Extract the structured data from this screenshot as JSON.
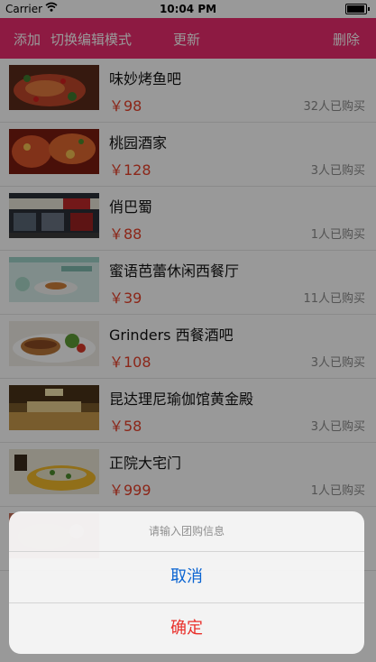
{
  "status_bar": {
    "carrier": "Carrier",
    "time": "10:04 PM"
  },
  "nav": {
    "add": "添加",
    "edit_mode": "切换编辑模式",
    "update": "更新",
    "delete": "删除"
  },
  "deals": [
    {
      "name": "味妙烤鱼吧",
      "price": "￥98",
      "sold": "32人已购买"
    },
    {
      "name": "桃园酒家",
      "price": "￥128",
      "sold": "3人已购买"
    },
    {
      "name": "俏巴蜀",
      "price": "￥88",
      "sold": "1人已购买"
    },
    {
      "name": "蜜语芭蕾休闲西餐厅",
      "price": "￥39",
      "sold": "11人已购买"
    },
    {
      "name": "Grinders 西餐酒吧",
      "price": "￥108",
      "sold": "3人已购买"
    },
    {
      "name": "昆达理尼瑜伽馆黄金殿",
      "price": "￥58",
      "sold": "3人已购买"
    },
    {
      "name": "正院大宅门",
      "price": "￥999",
      "sold": "1人已购买"
    },
    {
      "name": "",
      "price": "",
      "sold": ""
    }
  ],
  "action_sheet": {
    "title": "请输入团购信息",
    "cancel": "取消",
    "confirm": "确定"
  },
  "colors": {
    "nav": "#ec2c6f",
    "price": "#e8412a",
    "sheet_cancel": "#0a64d2",
    "sheet_confirm": "#e9302b"
  },
  "thumb_images": [
    "grilled-fish-photo",
    "peach-garden-dishes-photo",
    "storefront-photo",
    "western-restaurant-banner",
    "sandwich-photo",
    "yoga-hall-photo",
    "fish-dish-photo",
    "dish-photo"
  ]
}
